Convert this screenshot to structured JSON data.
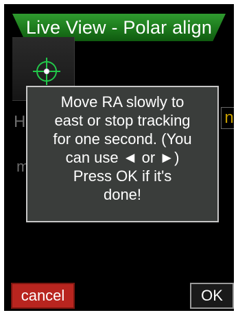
{
  "window": {
    "title": "Live View - Polar align"
  },
  "background": {
    "left_letter_1": "H",
    "left_letter_2": "m",
    "right_letter": "n"
  },
  "dialog": {
    "lines": [
      "Move RA slowly to",
      "east or stop tracking",
      "for one second. (You",
      "can use ◄ or ►)",
      "Press OK if it's",
      "done!"
    ]
  },
  "buttons": {
    "cancel_label": "cancel",
    "ok_label": "OK"
  },
  "colors": {
    "title_bar": "#1f7f1f",
    "reticle": "#22c84a",
    "cancel_bg": "#b8251f",
    "dialog_bg": "#3a3d3b",
    "accent_text": "#c8a000"
  },
  "icons": {
    "target": "crosshair-reticle-icon"
  }
}
